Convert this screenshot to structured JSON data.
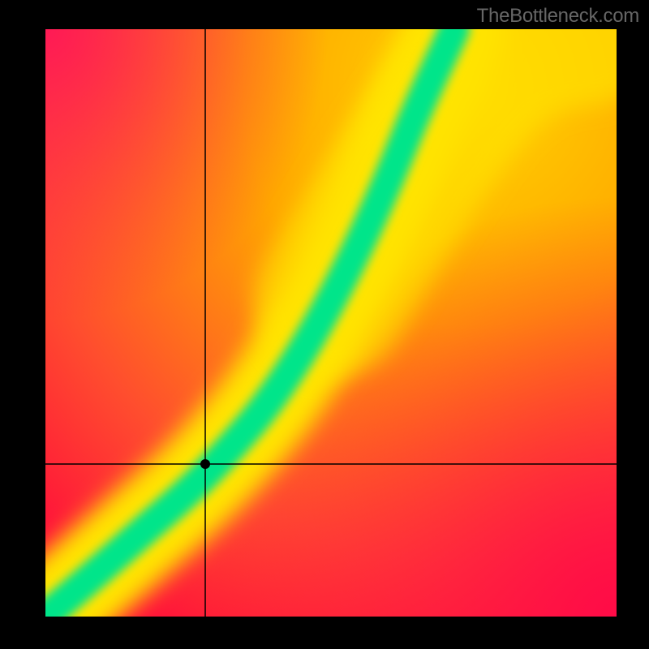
{
  "watermark": "TheBottleneck.com",
  "chart_data": {
    "type": "heatmap",
    "title": "",
    "xlabel": "",
    "ylabel": "",
    "xlim": [
      0,
      1
    ],
    "ylim": [
      0,
      1
    ],
    "frame_color": "#000000",
    "watermark_color": "#666666",
    "marker": {
      "x": 0.28,
      "y": 0.26,
      "color": "#000000"
    },
    "crosshair": {
      "vertical": 0.28,
      "horizontal": 0.26,
      "color": "#000000"
    },
    "ridge": {
      "description": "green ridge of peak compatibility from bottom-left to the top edge (curves right of diagonal), slight broadening towards the right edge beyond y~0.55",
      "points": [
        {
          "x": 0.0,
          "y": 0.0
        },
        {
          "x": 0.1,
          "y": 0.08
        },
        {
          "x": 0.2,
          "y": 0.17
        },
        {
          "x": 0.28,
          "y": 0.26
        },
        {
          "x": 0.35,
          "y": 0.36
        },
        {
          "x": 0.42,
          "y": 0.48
        },
        {
          "x": 0.5,
          "y": 0.63
        },
        {
          "x": 0.57,
          "y": 0.78
        },
        {
          "x": 0.63,
          "y": 0.9
        },
        {
          "x": 0.68,
          "y": 1.0
        }
      ],
      "colors": {
        "peak": "#00e58a",
        "near": "#ffe400",
        "neutral": "#ff9a00",
        "far": "#ff0045"
      }
    },
    "background_gradient": {
      "top_right": "#ffd300",
      "top_left": "#ff1a4d",
      "bottom_left": "#ff003d",
      "bottom_right": "#ff1a4d"
    }
  }
}
